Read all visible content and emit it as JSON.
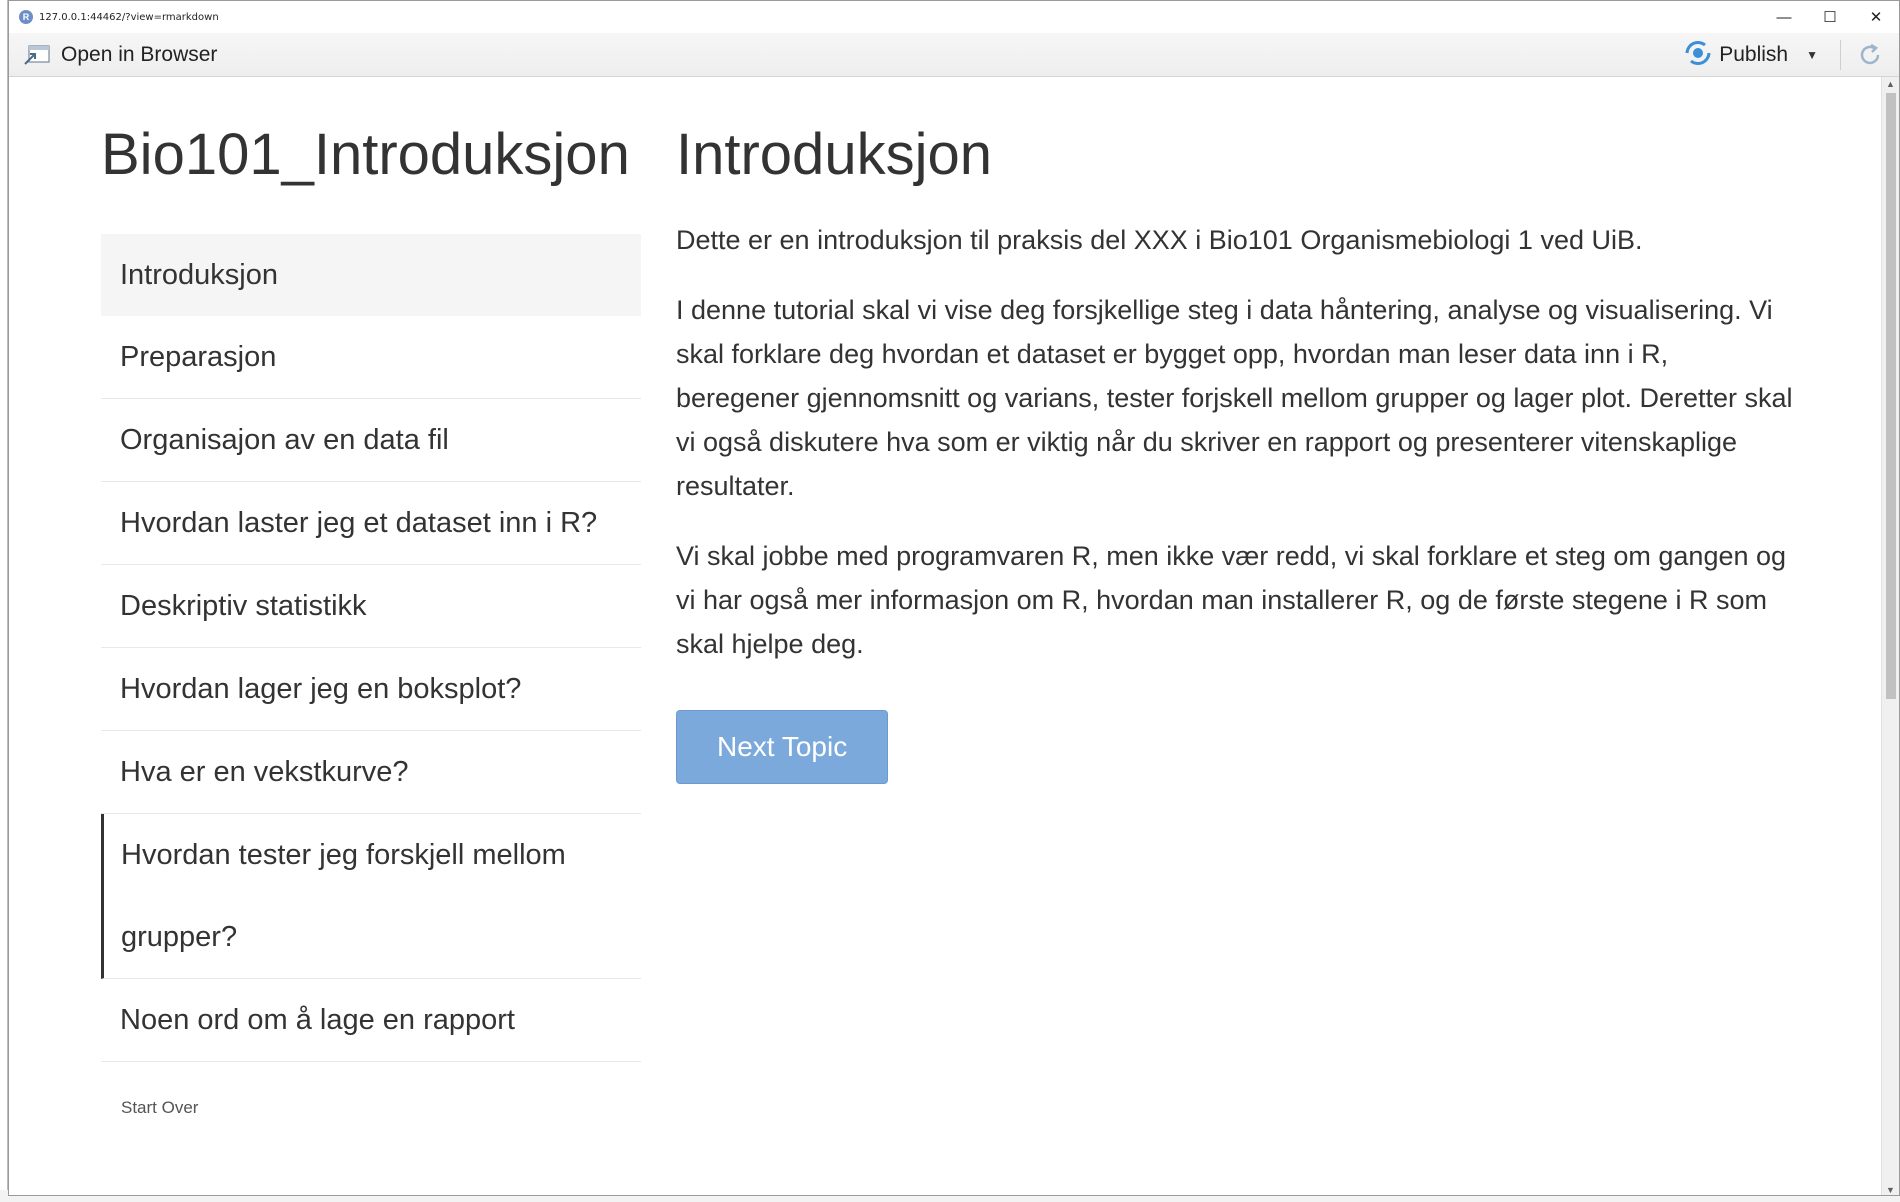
{
  "window": {
    "url": "127.0.0.1:44462/?view=rmarkdown",
    "app_icon": "R",
    "controls": {
      "minimize": "—",
      "maximize": "☐",
      "close": "✕"
    }
  },
  "toolbar": {
    "open_browser_label": "Open in Browser",
    "publish_label": "Publish"
  },
  "tutorial": {
    "title": "Bio101_Introduksjon",
    "nav_items": [
      "Introduksjon",
      "Preparasjon",
      "Organisajon av en data fil",
      "Hvordan laster jeg et dataset inn i R?",
      "Deskriptiv statistikk",
      "Hvordan lager jeg en boksplot?",
      "Hva er en vekstkurve?",
      "Hvordan tester jeg forskjell mellom",
      "grupper?",
      "Noen ord om å lage en rapport"
    ],
    "start_over": "Start Over"
  },
  "content": {
    "heading": "Introduksjon",
    "paragraphs": [
      "Dette er en introduksjon til praksis del XXX i Bio101 Organismebiologi 1 ved UiB.",
      "I denne tutorial skal vi vise deg forsjkellige steg i data håntering, analyse og visualisering. Vi skal forklare deg hvordan et dataset er bygget opp, hvordan man leser data inn i R, beregener gjennomsnitt og varians, tester forjskell mellom grupper og lager plot. Deretter skal vi også diskutere hva som er viktig når du skriver en rapport og presenterer vitenskaplige resultater.",
      "Vi skal jobbe med programvaren R, men ikke vær redd, vi skal forklare et steg om gangen og vi har også mer informasjon om R, hvordan man installerer R, og de første stegene i R som skal hjelpe deg."
    ],
    "next_button": "Next Topic"
  },
  "colors": {
    "accent": "#7ba9dc",
    "publish_icon": "#3a8fd6"
  },
  "icons": [
    "open-in-browser-icon",
    "publish-icon",
    "chevron-down-icon",
    "refresh-icon"
  ]
}
